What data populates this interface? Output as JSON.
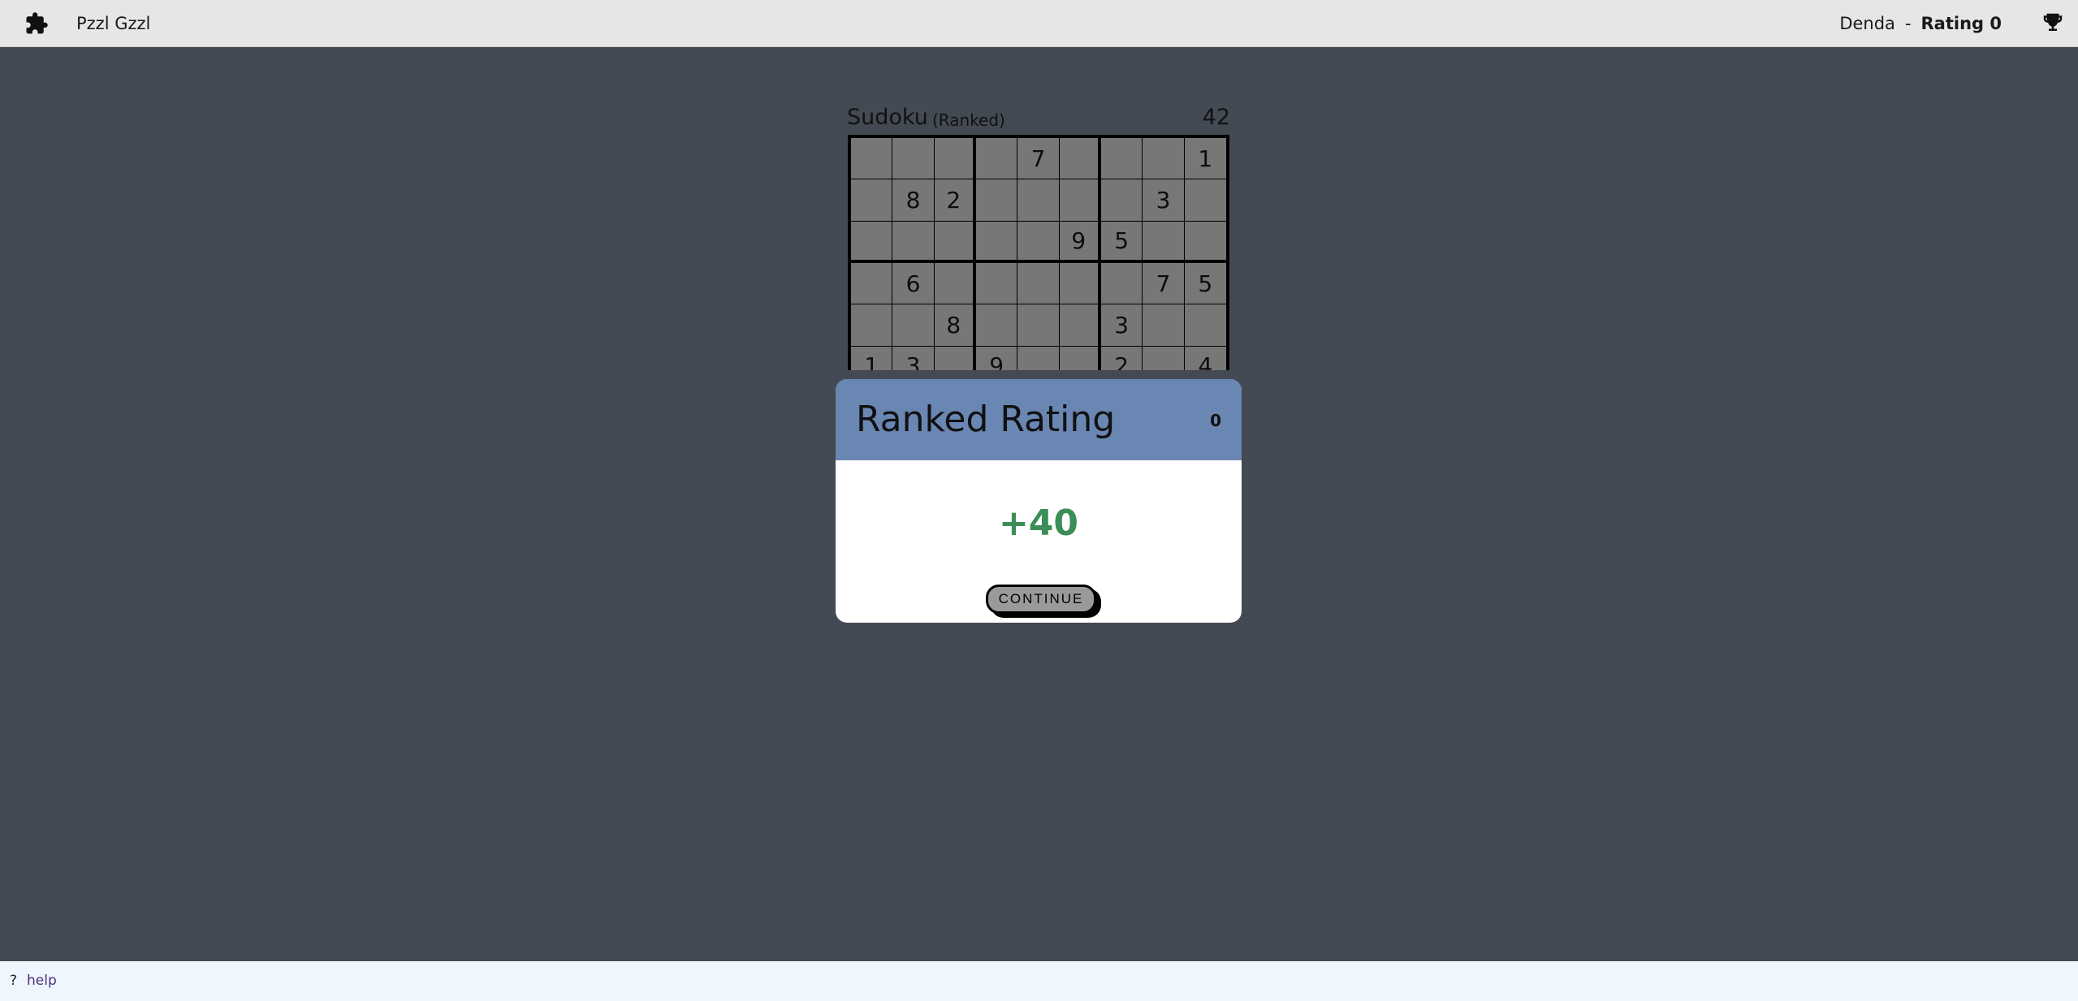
{
  "header": {
    "app_title": "Pzzl Gzzl",
    "logo_icon": "puzzle-piece-icon",
    "username": "Denda",
    "separator": "-",
    "rating_label": "Rating 0",
    "trophy_icon": "trophy-icon"
  },
  "puzzle": {
    "name": "Sudoku",
    "mode": "(Ranked)",
    "number": "42",
    "rows": [
      [
        "",
        "",
        "",
        "",
        "7",
        "",
        "",
        "",
        "1"
      ],
      [
        "",
        "8",
        "2",
        "",
        "",
        "",
        "",
        "3",
        ""
      ],
      [
        "",
        "",
        "",
        "",
        "",
        "9",
        "5",
        "",
        ""
      ],
      [
        "",
        "6",
        "",
        "",
        "",
        "",
        "",
        "7",
        "5"
      ],
      [
        "",
        "",
        "8",
        "",
        "",
        "",
        "3",
        "",
        ""
      ],
      [
        "1",
        "3",
        "",
        "9",
        "",
        "",
        "2",
        "",
        "4"
      ]
    ]
  },
  "modal": {
    "title": "Ranked Rating",
    "rating_value": "0",
    "delta": "+40",
    "delta_color": "#3b8e57",
    "header_color": "#6a86b3",
    "continue_label": "CONTINUE"
  },
  "footer": {
    "help_icon": "?",
    "help_label": "help"
  }
}
